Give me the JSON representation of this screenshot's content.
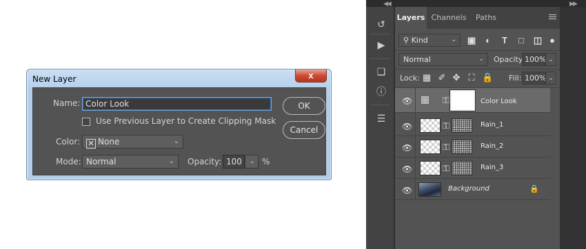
{
  "dialog": {
    "title": "New Layer",
    "close_label": "x",
    "name_label": "Name:",
    "name_value": "Color Look",
    "clip_label": "Use Previous Layer to Create Clipping Mask",
    "clip_checked": false,
    "color_label": "Color:",
    "color_value": "None",
    "color_swatch": "✕",
    "mode_label": "Mode:",
    "mode_value": "Normal",
    "opacity_label": "Opacity:",
    "opacity_value": "100",
    "opacity_unit": "%",
    "ok_label": "OK",
    "cancel_label": "Cancel"
  },
  "panel": {
    "tabs": [
      {
        "label": "Layers",
        "active": true
      },
      {
        "label": "Channels",
        "active": false
      },
      {
        "label": "Paths",
        "active": false
      }
    ],
    "filter_value": "Kind",
    "blend_mode": "Normal",
    "opacity_label": "Opacity:",
    "opacity_value": "100%",
    "lock_label": "Lock:",
    "fill_label": "Fill:",
    "fill_value": "100%",
    "layers": [
      {
        "name": "Color Look",
        "type": "adjustment",
        "selected": true
      },
      {
        "name": "Rain_1",
        "type": "masked",
        "selected": false
      },
      {
        "name": "Rain_2",
        "type": "masked",
        "selected": false
      },
      {
        "name": "Rain_3",
        "type": "masked",
        "selected": false
      },
      {
        "name": "Background",
        "type": "background",
        "selected": false
      }
    ]
  },
  "colors": {
    "panel_bg": "#535353",
    "dock_bg": "#323232",
    "selected_row": "#6a6a6a",
    "dialog_frame": "#b4cee9",
    "close_button": "#cc4a33"
  }
}
